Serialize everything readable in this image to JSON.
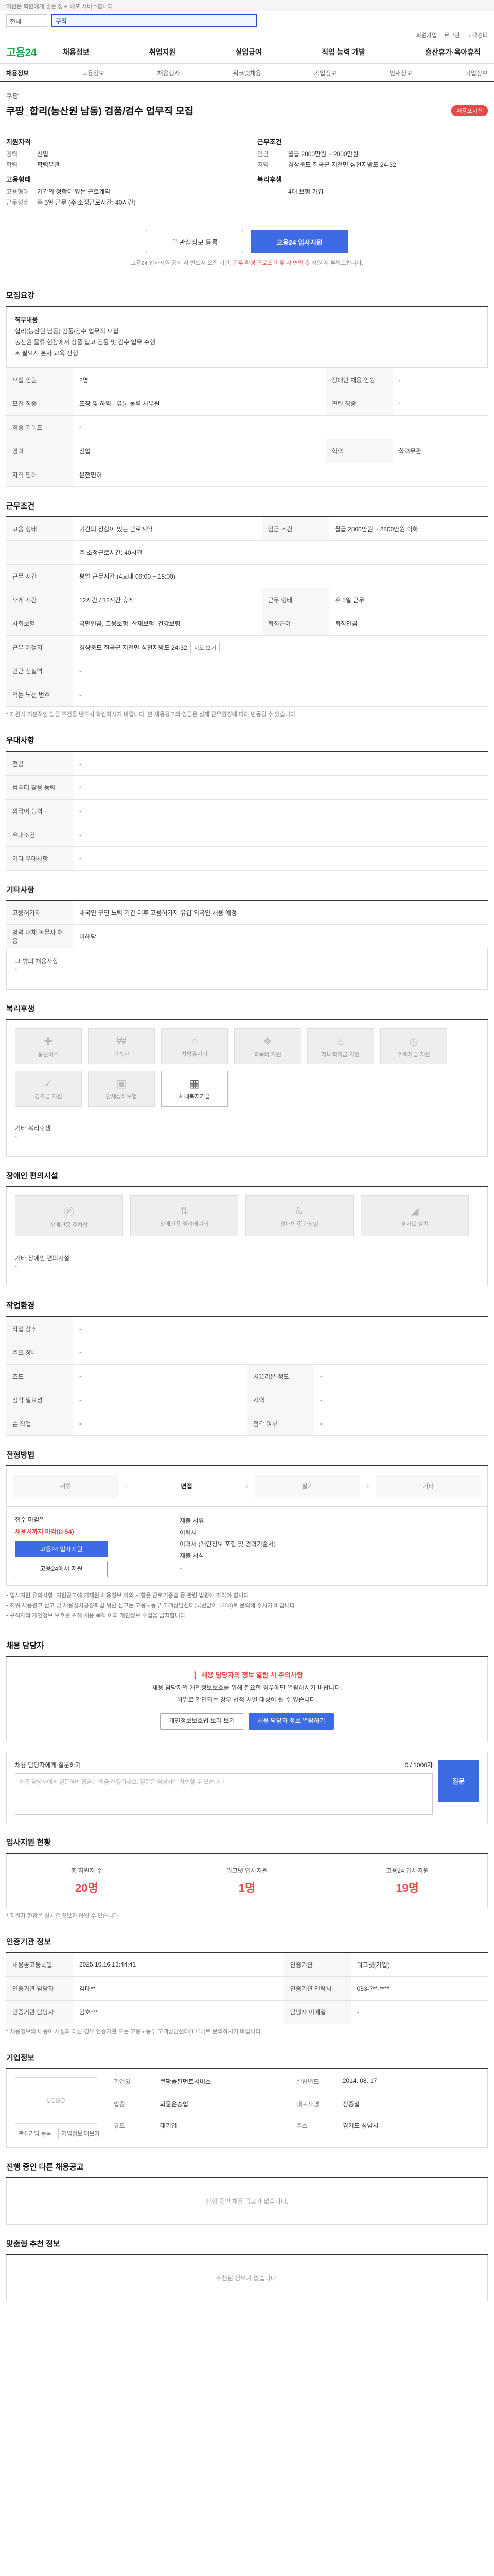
{
  "top_notice": "지원은 회원에게 좋은 정보 배포 서비스합니다",
  "search": {
    "select_label": "전체",
    "query": "구직"
  },
  "util_links": [
    "회원가입",
    "로그인",
    "고객센터"
  ],
  "logo": {
    "main": "고용",
    "num": "24"
  },
  "gnb": [
    "채용정보",
    "취업지원",
    "실업급여",
    "직업 능력 개발",
    "출산휴가·육아휴직"
  ],
  "subnav": [
    "채용정보",
    "고용정보",
    "채용행사",
    "워크넷채용",
    "기업정보",
    "인재정보",
    "기업정보"
  ],
  "header": {
    "company": "쿠팡",
    "title": "쿠팡_합리(농산원 남동) 검품/검수 업무직 모집",
    "badge": "채용포지션"
  },
  "summary": {
    "left_head1": "지원자격",
    "left": [
      {
        "k": "경력",
        "v": "신입"
      },
      {
        "k": "학력",
        "v": "학력무관"
      }
    ],
    "left_head2": "고용형태",
    "left2": [
      {
        "k": "고용형태",
        "v": "기간의 정함이 있는 근로계약"
      },
      {
        "k": "근무형태",
        "v": "주 5일 근무 (주 소정근로시간: 40시간)"
      }
    ],
    "right_head1": "근무조건",
    "right": [
      {
        "k": "임금",
        "v": "월급 2800만원 ~ 2800만원"
      },
      {
        "k": "지역",
        "v": "경상북도 칠곡군 지천면 심천지방도 24-32"
      }
    ],
    "right_head2": "복리후생",
    "right2": [
      {
        "k": "",
        "v": "4대 보험 가입"
      }
    ]
  },
  "actions": {
    "scrap": "관심정보 등록",
    "apply": "고용24 입사지원",
    "notice_pre": "고용24 입사지원 공지 시 반드시 모집 기간,",
    "notice_red": "근무 환경 근로조건 및 시 연락 후",
    "notice_post": "지원 시 부탁드립니다."
  },
  "sections": {
    "recruit": "모집요강",
    "conditions": "근무조건",
    "preference": "우대사항",
    "other": "기타사항",
    "welfare": "복리후생",
    "access": "장애인 편의시설",
    "env": "작업환경",
    "process": "전형방법",
    "manager": "채용 담당자",
    "status": "입사지원 현황",
    "company_info": "인증기관 정보",
    "company": "기업정보",
    "other_jobs": "진행 중인 다른 채용공고",
    "ai": "맞춤형 추천 정보"
  },
  "recruit_box": {
    "duty_head": "직무내용",
    "duty_1": "합리(농산원 남동) 검품/검수 업무직 모집",
    "duty_2": "농산원 물류 현장에서 상품 입고 검품 및 검수 업무 수행",
    "duty_3": "※ 필요시 본사 교육 진행"
  },
  "recruit_table": [
    [
      "모집 인원",
      "2명",
      "장애인 채용 인원",
      "-"
    ],
    [
      "모집 직종",
      "포장 및 하역 · 유통 물류 사무원",
      "관련 직종",
      "-"
    ],
    [
      "직종 키워드",
      "-",
      "",
      ""
    ],
    [
      "경력",
      "신입",
      "학력",
      "학력무관"
    ],
    [
      "자격 면허",
      "운전면허",
      "",
      ""
    ]
  ],
  "cond_table": [
    [
      "고용 형태",
      "기간의 정함이 있는 근로계약",
      "임금 조건",
      "월급 2800만원 ~ 2800만원 이하"
    ],
    [
      "",
      "주 소정근로시간: 40시간",
      "",
      ""
    ],
    [
      "근무 시간",
      "평일 근무시간  (4교대 09:00 ~ 18:00)",
      "",
      ""
    ],
    [
      "휴게 시간",
      "12시간 / 12시간 휴게",
      "근무 형태",
      "주 5일 근무"
    ],
    [
      "사회보험",
      "국민연금, 고용보험, 산재보험, 건강보험",
      "퇴직급여",
      "퇴직연금"
    ],
    [
      "근무 예정지",
      "경상북도 칠곡군 지천면 심천지방도 24-32",
      "",
      ""
    ],
    [
      "인근 전철역",
      "-",
      "",
      ""
    ],
    [
      "먹는 노선 번호",
      "-",
      "",
      ""
    ]
  ],
  "cond_note": "* 지원시 기본적인 임금 조건을 반드시 확인하시기 바랍니다. 본 채용공고의 임금은 실제 근무환경에 따라 변동될 수 있습니다.",
  "map_btn": "지도 보기",
  "pref_table": [
    [
      "전공",
      "-"
    ],
    [
      "컴퓨터 활용 능력",
      "-"
    ],
    [
      "외국어 능력",
      "-"
    ],
    [
      "우대조건",
      "-"
    ],
    [
      "기타 우대사항",
      "-"
    ]
  ],
  "other_table": [
    [
      "고용허가제",
      "내국인 구인 노력 기간 이후 고용허가제 유입 외국인 채용 예정"
    ],
    [
      "병역 대체 복무자 채용",
      "비해당"
    ]
  ],
  "other_etc_label": "그 밖의 채용사항",
  "other_etc_value": "-",
  "welfare_items": [
    {
      "icon": "health-icon",
      "label": "통근버스",
      "on": false
    },
    {
      "icon": "money-icon",
      "label": "기숙사",
      "on": false
    },
    {
      "icon": "house-icon",
      "label": "차량유지비",
      "on": false
    },
    {
      "icon": "gift-icon",
      "label": "교육비 지원",
      "on": false
    },
    {
      "icon": "meal-icon",
      "label": "자녀학자금 지원",
      "on": false
    },
    {
      "icon": "clock-icon",
      "label": "주택자금 지원",
      "on": false
    },
    {
      "icon": "check-icon",
      "label": "경조금 지원",
      "on": false
    },
    {
      "icon": "bus-icon",
      "label": "단체상해보험",
      "on": false
    },
    {
      "icon": "box-icon",
      "label": "사내복지기금",
      "on": true
    }
  ],
  "welfare_etc_label": "기타 복리후생",
  "welfare_etc_value": "-",
  "access_items": [
    {
      "label": "장애인용 주차장",
      "on": false
    },
    {
      "label": "장애인용 엘리베이터",
      "on": false
    },
    {
      "label": "장애인용 화장실",
      "on": false
    },
    {
      "label": "경사로 설치",
      "on": false
    }
  ],
  "access_etc_label": "기타 장애인 편의시설",
  "access_etc_value": "-",
  "env_table": [
    [
      "작업 장소",
      "-",
      "",
      ""
    ],
    [
      "주요 장비",
      "-",
      "",
      ""
    ],
    [
      "조도",
      "-",
      "시끄러운 정도",
      "-"
    ],
    [
      "청각 필요성",
      "-",
      "시력",
      "-"
    ],
    [
      "손 작업",
      "-",
      "청각 여부",
      "-"
    ]
  ],
  "process_steps": [
    {
      "label": "서류",
      "on": false
    },
    {
      "label": "면접",
      "on": true
    },
    {
      "label": "필기",
      "on": false
    },
    {
      "label": "기타",
      "on": false
    }
  ],
  "apply_info": {
    "method_head": "접수 마감일",
    "deadline": "채용시까지 마감(D-54)",
    "apply_btn": "고용24 입사지원",
    "email_btn": "고용24에서 지원",
    "doc_head": "제출 서류",
    "doc_1": "이력서",
    "doc_2": "이력서 (개인정보 포함 및 경력기술서)",
    "doc_form_head": "제출 서식",
    "doc_form": "-"
  },
  "apply_notes": [
    "• 입사지원 유의사항: 지원공고에 기재된 채용정보 이외 사항은 근로기준법 등 관련 법령에 따라야 합니다.",
    "• 허위 채용광고 신고 및 채용절차공정화법 위반 신고는 고용노동부 고객상담센터(국번없이 1350)로 문의해 주시기 바랍니다.",
    "• 구직자의 개인정보 보호를 위해 채용 목적 이외 개인정보 수집을 금지합니다."
  ],
  "manager": {
    "warn": "채용 담당자의 정보 열람 시 주의사항",
    "line1": "채용 담당자의 개인정보보호를 위해 필요한 경우에만 열람하시기 바랍니다.",
    "line2": "허위로 확인되는 경우 법적 처벌 대상이 될 수 있습니다.",
    "btn1": "개인정보보호법 보러 보기",
    "btn2": "채용 담당자 정보 열람하기"
  },
  "qa": {
    "head": "채용 담당자에게 질문하기",
    "right": "0 / 1000자",
    "placeholder": "채용 담당자에게 질문하여 궁금한 점을 해결하세요. 질문은 담당자만 확인할 수 있습니다.",
    "submit": "질문"
  },
  "status": [
    {
      "label": "총 지원자 수",
      "value": "20명"
    },
    {
      "label": "워크넷 입사지원",
      "value": "1명"
    },
    {
      "label": "고용24 입사지원",
      "value": "19명"
    }
  ],
  "status_note": "* 지원자 현황은 실시간 정보가 아닐 수 있습니다.",
  "info_table": [
    [
      "채용공고등록일",
      "2025.10.16 13:44:41",
      "인증기관",
      "워크넷(가입)"
    ],
    [
      "인증기관 담당자",
      "김태**",
      "인증기관 연락처",
      "053-7**-****"
    ],
    [
      "인증기관 담당자",
      "김호***",
      "담당자 이메일",
      "-"
    ]
  ],
  "info_note": "* 채용정보의 내용이 사실과 다른 경우 인증기관 또는 고용노동부 고객상담센터(1350)로 문의하시기 바랍니다.",
  "company": {
    "logo": "LOGO",
    "rows": [
      [
        "기업명",
        "쿠팡풀필먼트서비스",
        "설립년도",
        "2014. 08. 17"
      ],
      [
        "업종",
        "화물운송업",
        "대표자명",
        "정종철"
      ],
      [
        "규모",
        "대기업",
        "주소",
        "경기도 성남시"
      ]
    ],
    "buttons": [
      "관심기업 등록",
      "기업정보 더보기"
    ]
  },
  "other_jobs_empty": "진행 중인 채용 공고가 없습니다.",
  "ai_empty": "추천된 정보가 없습니다."
}
